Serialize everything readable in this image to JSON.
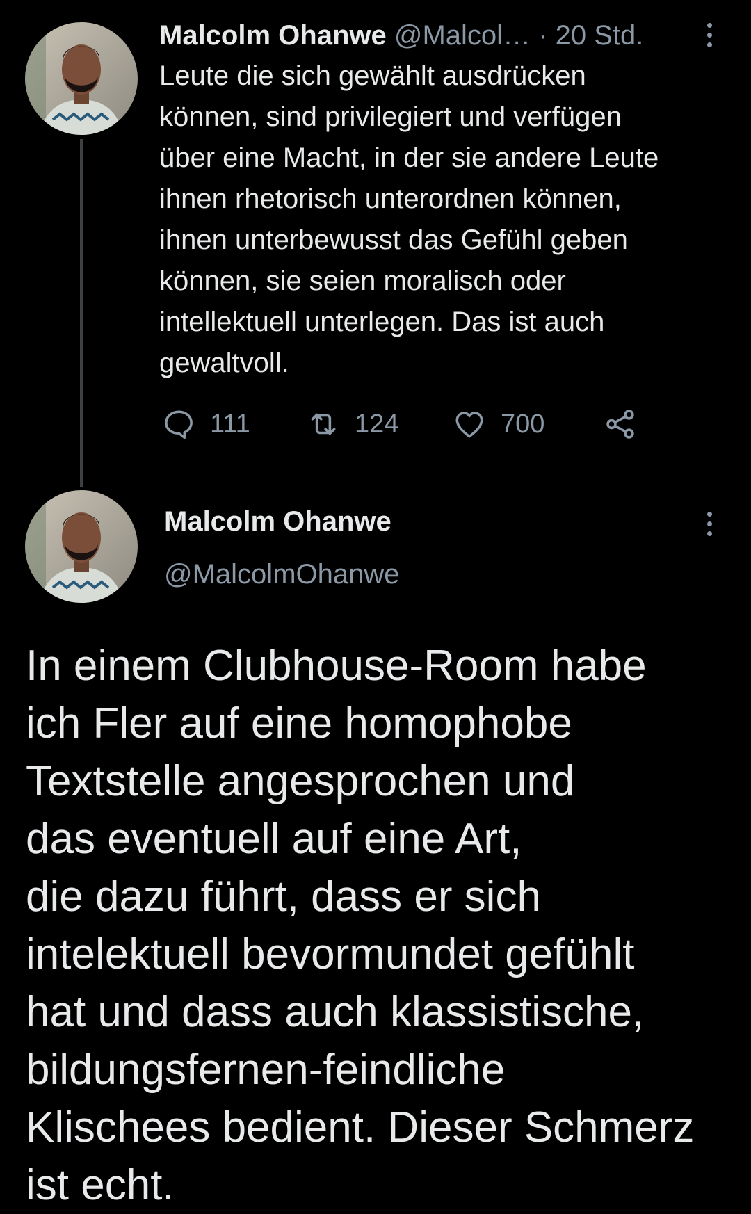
{
  "tweet1": {
    "author_name": "Malcolm Ohanwe",
    "handle": "@Malcol…",
    "separator": "·",
    "time": "20 Std.",
    "text": "Leute die sich gewählt ausdrücken\nkönnen, sind privilegiert und verfügen\nüber eine Macht, in der sie andere Leute\nihnen rhetorisch unterordnen können,\nihnen unterbewusst das Gefühl geben\nkönnen, sie seien moralisch oder\nintellektuell unterlegen. Das ist auch\ngewaltvoll.",
    "actions": {
      "reply_icon": "reply-icon",
      "replies": "111",
      "retweet_icon": "retweet-icon",
      "retweets": "124",
      "like_icon": "heart-icon",
      "likes": "700",
      "share_icon": "share-icon"
    }
  },
  "tweet2": {
    "author_name": "Malcolm Ohanwe",
    "handle": "@MalcolmOhanwe",
    "text": "In einem Clubhouse-Room habe\nich Fler auf eine homophobe\nTextstelle angesprochen und\ndas eventuell auf eine Art,\ndie dazu führt, dass er sich\nintelektuell bevormundet gefühlt\nhat und dass auch klassistische,\nbildungsfernen-feindliche\nKlischees bedient. Dieser Schmerz\nist echt."
  },
  "colors": {
    "background": "#000000",
    "text_primary": "#e7e9ea",
    "text_secondary": "#8b98a5",
    "thread_line": "#3e4144"
  }
}
